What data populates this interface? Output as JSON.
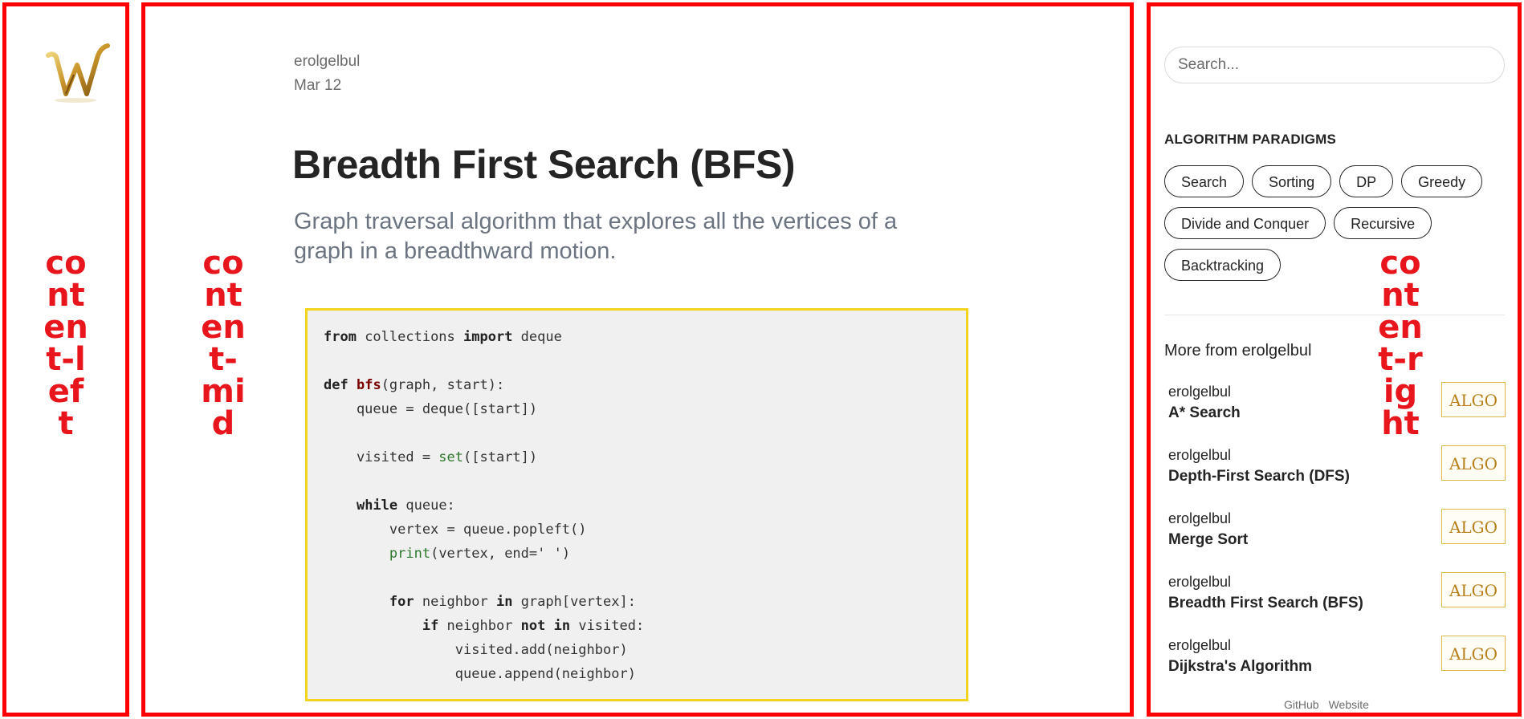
{
  "annotations": {
    "left": "content-left",
    "mid": "content-mid",
    "right": "content-right"
  },
  "article": {
    "author": "erolgelbul",
    "date": "Mar 12",
    "title": "Breadth First Search (BFS)",
    "subtitle": "Graph traversal algorithm that explores all the vertices of a graph in a breadthward motion."
  },
  "sidebar": {
    "search_placeholder": "Search...",
    "paradigms_title": "ALGORITHM PARADIGMS",
    "paradigms": [
      "Search",
      "Sorting",
      "DP",
      "Greedy",
      "Divide and Conquer",
      "Recursive",
      "Backtracking"
    ],
    "more_title": "More from erolgelbul",
    "posts": [
      {
        "author": "erolgelbul",
        "title": "A* Search",
        "thumb_text": "ALGO"
      },
      {
        "author": "erolgelbul",
        "title": "Depth-First Search (DFS)",
        "thumb_text": "ALGO"
      },
      {
        "author": "erolgelbul",
        "title": "Merge Sort",
        "thumb_text": "ALGO"
      },
      {
        "author": "erolgelbul",
        "title": "Breadth First Search (BFS)",
        "thumb_text": "ALGO"
      },
      {
        "author": "erolgelbul",
        "title": "Dijkstra's Algorithm",
        "thumb_text": "ALGO"
      }
    ],
    "footer_links": [
      "GitHub",
      "Website"
    ]
  },
  "colors": {
    "annotation_red": "#e8161c",
    "code_border": "#f2d31d",
    "code_bg": "#f0f0f0",
    "logo_gold": "#c9952b"
  },
  "icons": {
    "logo": "w-monogram-gold-logo"
  }
}
